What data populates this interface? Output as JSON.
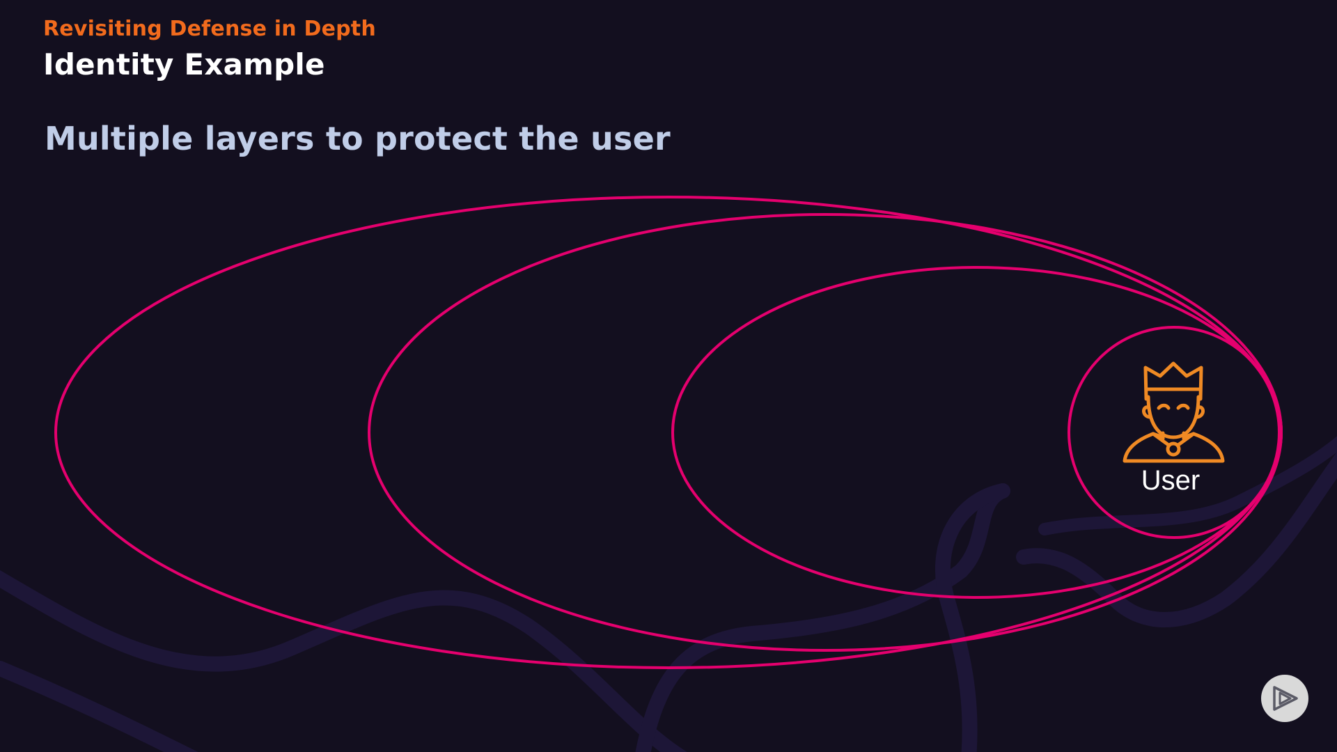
{
  "header": {
    "kicker": "Revisiting Defense in Depth",
    "title": "Identity Example"
  },
  "content": {
    "subtitle": "Multiple layers to protect the user"
  },
  "diagram": {
    "layer_count": 4,
    "center_label": "User",
    "center_icon": "king-user-icon"
  },
  "controls": {
    "play_icon": "play-icon"
  },
  "colors": {
    "background": "#130f1f",
    "kicker": "#f26b1d",
    "title": "#ffffff",
    "subtitle": "#c0cde8",
    "layer_stroke": "#e5006e",
    "icon": "#f08a24",
    "label": "#ffffff",
    "swirl": "#1d1637",
    "play_fill": "#d9d9d9",
    "play_stroke": "#5a5a66"
  }
}
